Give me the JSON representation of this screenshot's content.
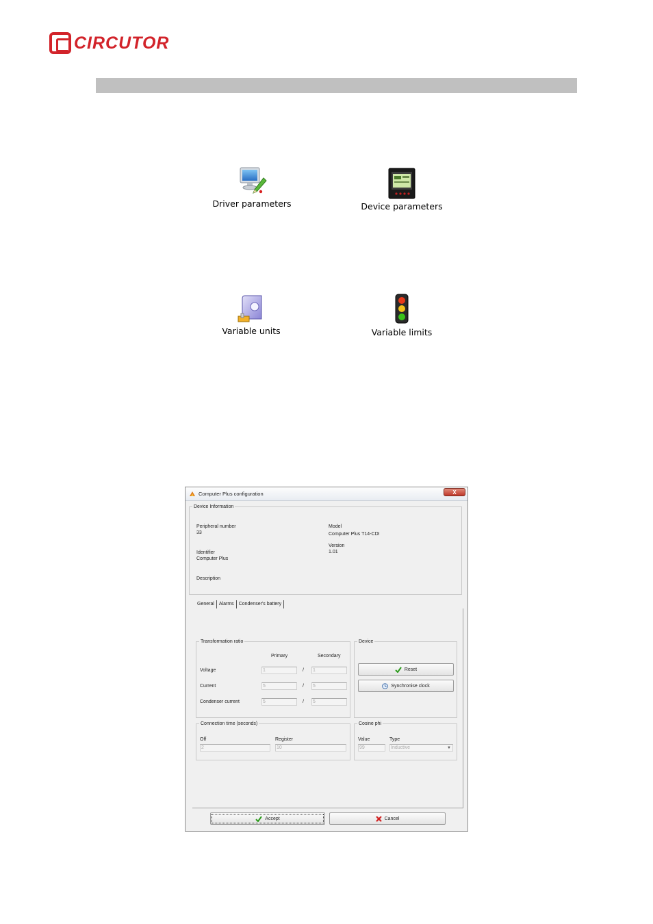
{
  "brand": {
    "name": "CIRCUTOR"
  },
  "icons": [
    {
      "label": "Driver parameters",
      "icon": "monitor-pencil-icon"
    },
    {
      "label": "Device parameters",
      "icon": "device-meter-icon"
    },
    {
      "label": "Variable units",
      "icon": "units-gear-icon"
    },
    {
      "label": "Variable limits",
      "icon": "traffic-light-icon"
    }
  ],
  "dialog": {
    "title": "Computer Plus configuration",
    "close_label": "X",
    "device_info": {
      "legend": "Device Information",
      "peripheral_label": "Peripheral number",
      "peripheral_value": "33",
      "model_label": "Model",
      "model_value": "Computer Plus T14-CDI",
      "version_label": "Version",
      "version_value": "1.01",
      "identifier_label": "Identifier",
      "identifier_value": "Computer Plus",
      "description_label": "Description"
    },
    "tabs": [
      "General",
      "Alarms",
      "Condenser's battery"
    ],
    "transformation": {
      "legend": "Transformation ratio",
      "primary_header": "Primary",
      "secondary_header": "Secondary",
      "separator": "/",
      "rows": [
        {
          "label": "Voltage",
          "primary": "1",
          "secondary": "1"
        },
        {
          "label": "Current",
          "primary": "5",
          "secondary": "5"
        },
        {
          "label": "Condenser current",
          "primary": "5",
          "secondary": "5"
        }
      ]
    },
    "device_box": {
      "legend": "Device",
      "reset_label": "Reset",
      "sync_label": "Synchronise clock"
    },
    "connection": {
      "legend": "Connection time (seconds)",
      "off_label": "Off",
      "off_value": "2",
      "register_label": "Register",
      "register_value": "10"
    },
    "cosine": {
      "legend": "Cosine phi",
      "value_label": "Value",
      "value_value": "99",
      "type_label": "Type",
      "type_value": "Inductive"
    },
    "accept_label": "Accept",
    "cancel_label": "Cancel"
  }
}
